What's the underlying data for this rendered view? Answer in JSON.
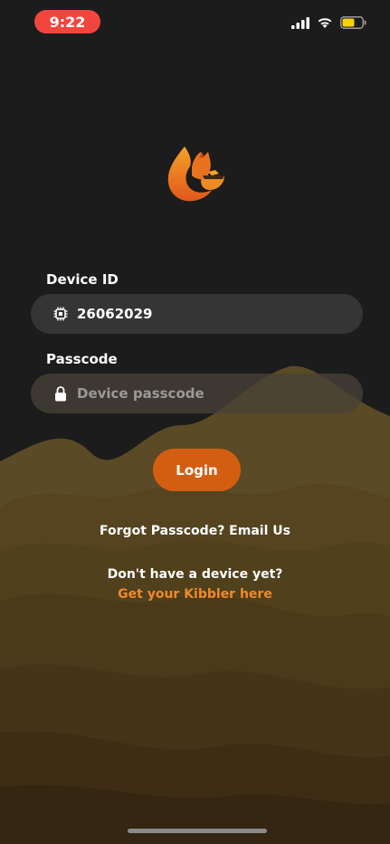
{
  "status_bar": {
    "time": "9:22",
    "battery_color": "#f5d20a"
  },
  "form": {
    "device_id_label": "Device ID",
    "device_id_value": "26062029",
    "passcode_label": "Passcode",
    "passcode_placeholder": "Device passcode",
    "login_label": "Login"
  },
  "links": {
    "forgot": "Forgot Passcode? Email Us",
    "no_device": "Don't have a device yet?",
    "get_kibbler": "Get your Kibbler here"
  },
  "colors": {
    "accent": "#d35e12",
    "link": "#f0892a",
    "background": "#1c1c1c",
    "time_pill": "#f2453d"
  },
  "icons": {
    "logo": "cat-with-bowl-logo",
    "device_id_field": "chip-icon",
    "passcode_field": "lock-icon"
  }
}
